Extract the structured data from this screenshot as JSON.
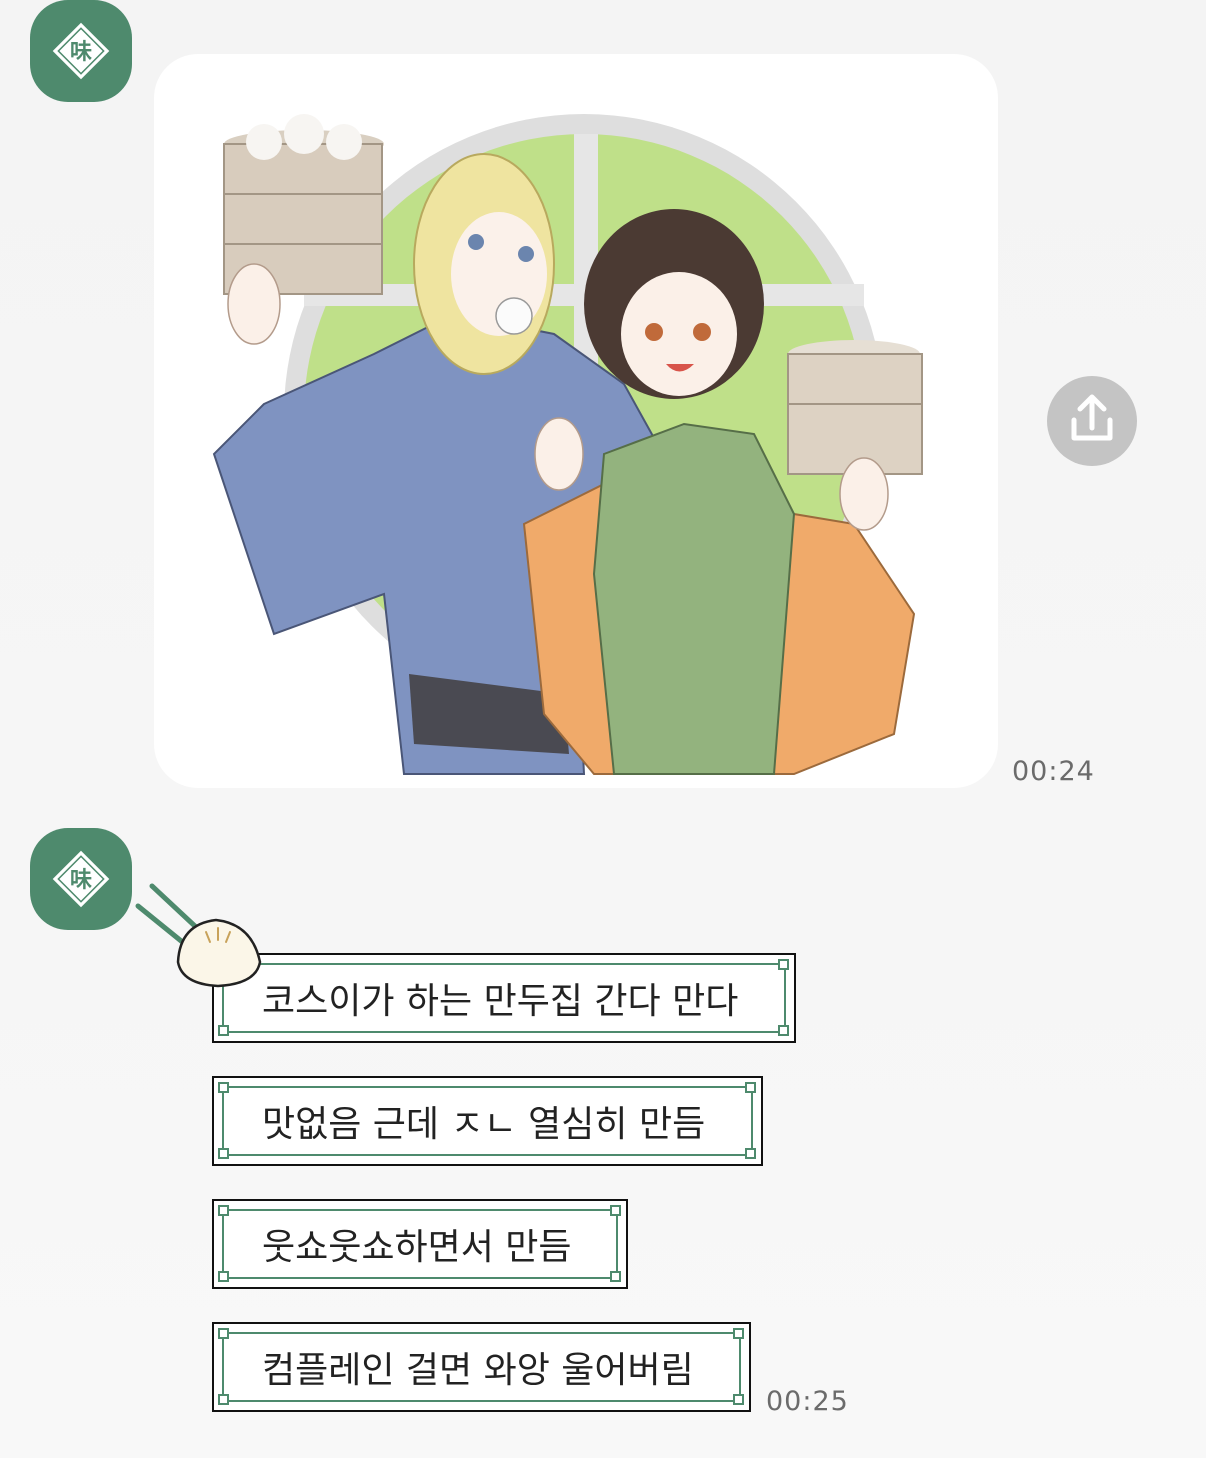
{
  "avatar": {
    "glyph": "味",
    "color": "#4e8a6d"
  },
  "image_message": {
    "time": "00:24"
  },
  "messages": [
    {
      "text": "코스이가 하는 만두집 간다 만다"
    },
    {
      "text": "맛없음 근데 ㅈㄴ 열심히 만듬"
    },
    {
      "text": "웃쇼웃쇼하면서 만듬"
    },
    {
      "text": "컴플레인 걸면 와앙 울어버림"
    }
  ],
  "last_time": "00:25",
  "icons": {
    "share": "share-upload-icon",
    "bun": "steamed-bun-chopsticks-icon"
  },
  "colors": {
    "accent": "#4e8a6d",
    "bubble_border": "#111111",
    "time": "#6b6b6b"
  }
}
